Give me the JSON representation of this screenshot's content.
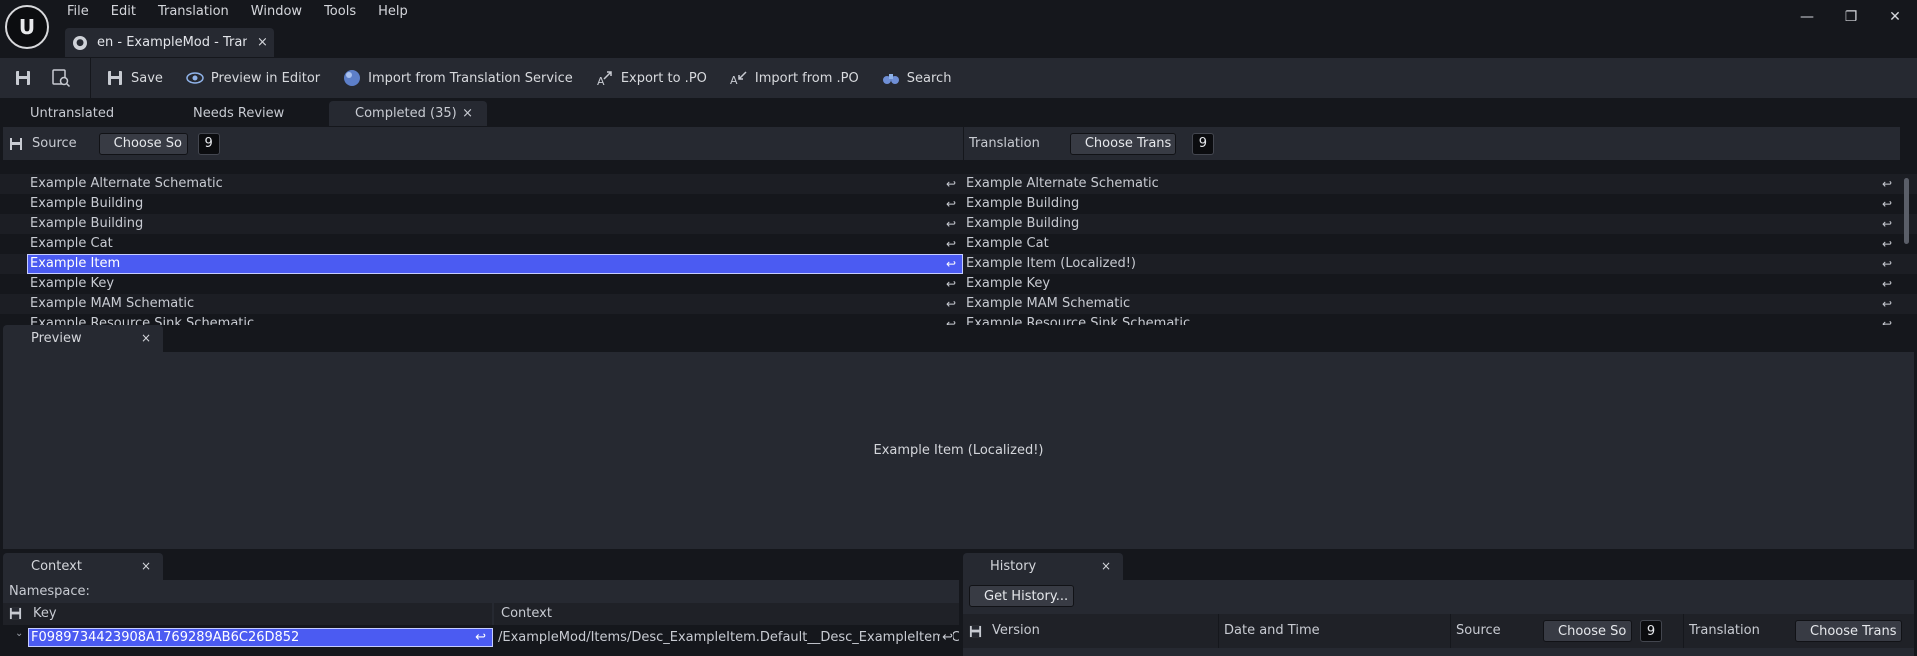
{
  "menu": [
    "File",
    "Edit",
    "Translation",
    "Window",
    "Tools",
    "Help"
  ],
  "doc_tab": {
    "label": "en - ExampleMod - Tran...",
    "close": "×"
  },
  "window_controls": {
    "minimize": "—",
    "restore": "❐",
    "close": "✕"
  },
  "toolbar": {
    "save": "Save",
    "preview": "Preview in Editor",
    "import_service": "Import from Translation Service",
    "export_po": "Export to .PO",
    "import_po": "Import from .PO",
    "search": "Search"
  },
  "status_tabs": {
    "untranslated": "Untranslated",
    "needs_review": "Needs Review",
    "completed": "Completed (35)",
    "close": "×"
  },
  "grid_header": {
    "source_label": "Source",
    "source_button": "Choose So",
    "source_count": "9",
    "translation_label": "Translation",
    "translation_button": "Choose Trans",
    "translation_count": "9"
  },
  "entries": [
    {
      "source": "Example Alternate Schematic",
      "translation": "Example Alternate Schematic"
    },
    {
      "source": "Example Building",
      "translation": "Example Building"
    },
    {
      "source": "Example Building",
      "translation": "Example Building"
    },
    {
      "source": "Example Cat",
      "translation": "Example Cat"
    },
    {
      "source": "Example Item",
      "translation": "Example Item (Localized!)",
      "selected": true
    },
    {
      "source": "Example Key",
      "translation": "Example Key"
    },
    {
      "source": "Example MAM Schematic",
      "translation": "Example MAM Schematic"
    },
    {
      "source": "Example Resource Sink Schematic",
      "translation": "Example Resource Sink Schematic"
    }
  ],
  "preview": {
    "tab": "Preview",
    "close": "×",
    "text": "Example Item (Localized!)"
  },
  "context": {
    "tab": "Context",
    "close": "×",
    "namespace_label": "Namespace:",
    "key_header": "Key",
    "context_header": "Context",
    "key_value": "F0989734423908A1769289AB6C26D852",
    "context_value": "/ExampleMod/Items/Desc_ExampleItem.Default__Desc_ExampleItem_C.mDisplayN"
  },
  "history": {
    "tab": "History",
    "close": "×",
    "get_history": "Get History...",
    "version": "Version",
    "date_time": "Date and Time",
    "source": "Source",
    "source_button": "Choose So",
    "source_count": "9",
    "translation": "Translation",
    "translation_button": "Choose Trans"
  },
  "colors": {
    "accent": "#4b5bf2",
    "panel": "#262931",
    "background": "#15171c"
  }
}
